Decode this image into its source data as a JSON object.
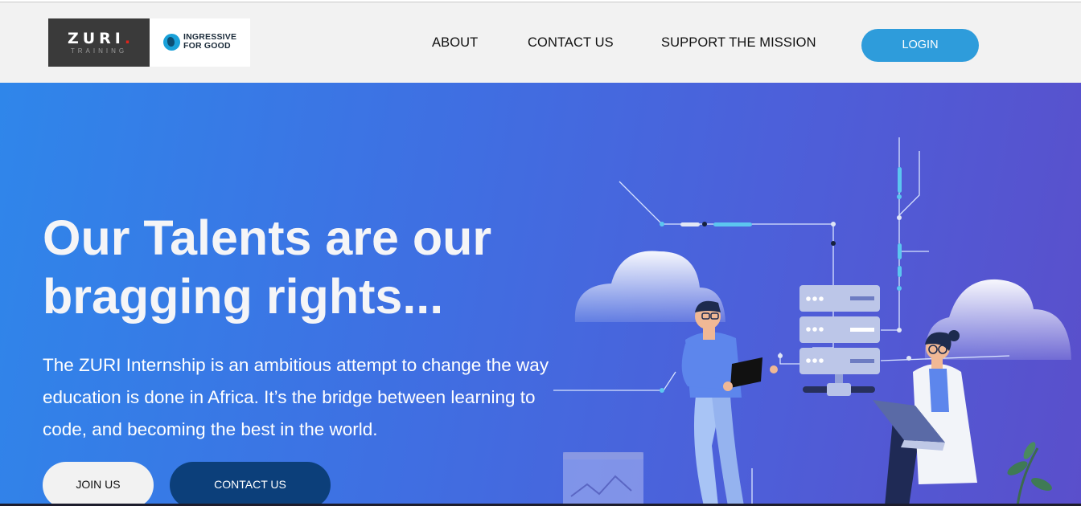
{
  "logos": {
    "zuri_word": "ZURI",
    "zuri_dot": ".",
    "zuri_sub": "TRAINING",
    "ingressive_line1": "INGRESSIVE",
    "ingressive_line2": "FOR GOOD"
  },
  "nav": {
    "items": [
      {
        "label": "ABOUT"
      },
      {
        "label": "CONTACT US"
      },
      {
        "label": "SUPPORT THE MISSION"
      }
    ],
    "login_label": "LOGIN"
  },
  "hero": {
    "title_line1": "Our Talents are our",
    "title_line2": "bragging rights...",
    "description": "The ZURI Internship is an ambitious attempt to change the way education is done in Africa. It’s the bridge between learning to code, and becoming the best in the world.",
    "join_label": "JOIN US",
    "contact_label": "CONTACT US"
  },
  "colors": {
    "header_bg": "#f2f2f2",
    "login_button": "#2e9cdb",
    "contact_button": "#0c3f7a",
    "hero_gradient_start": "#2f86ea",
    "hero_gradient_end": "#5a4fcb"
  },
  "illustration": {
    "icons": [
      "cloud-icon",
      "server-rack-icon",
      "man-with-tablet-icon",
      "woman-with-laptop-icon",
      "circuit-lines-icon",
      "chart-window-icon",
      "plant-icon"
    ]
  }
}
